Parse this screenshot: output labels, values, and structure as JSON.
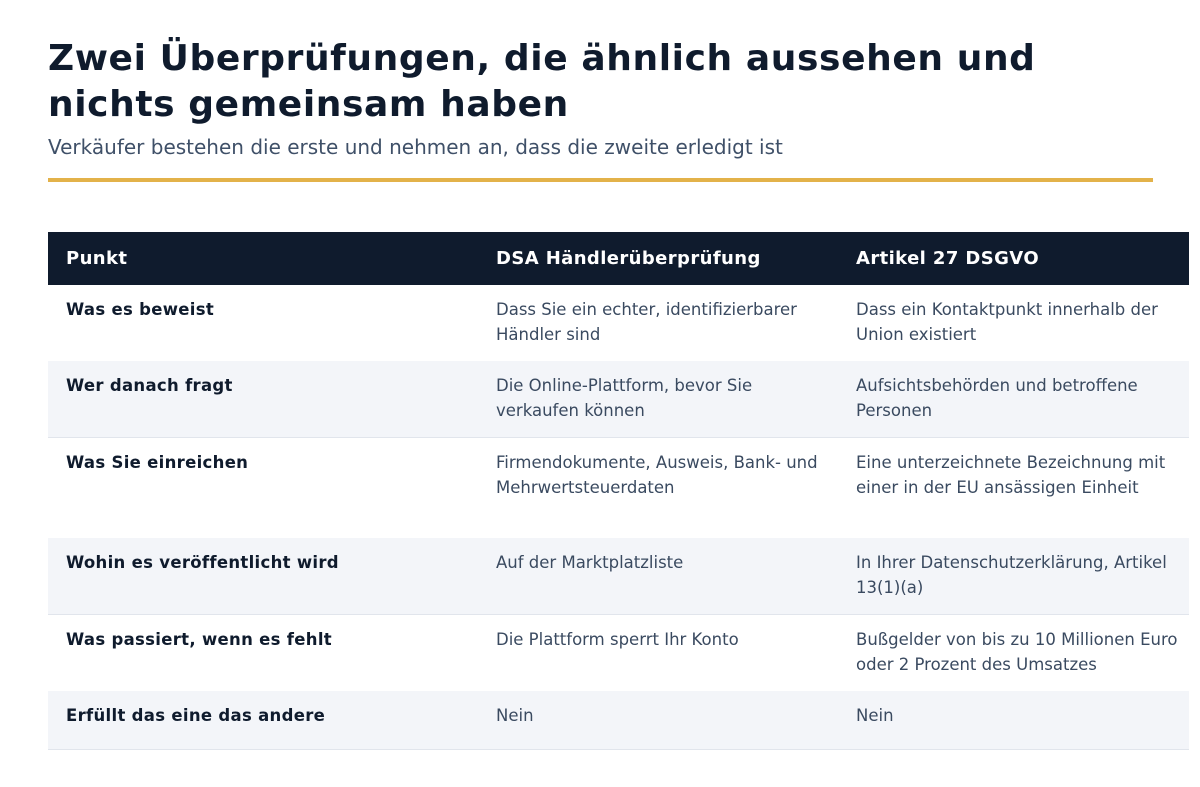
{
  "header": {
    "title": "Zwei Überprüfungen, die ähnlich aussehen und nichts gemeinsam haben",
    "subtitle": "Verkäufer bestehen die erste und nehmen an, dass die zweite erledigt ist",
    "accent_color": "#e3b24a"
  },
  "table": {
    "headers": [
      "Punkt",
      "DSA Händlerüberprüfung",
      "Artikel 27 DSGVO"
    ],
    "header_bg": "#0f1b2d",
    "rows": [
      [
        "Was es beweist",
        "Dass Sie ein echter, identifizierbarer Händler sind",
        "Dass ein Kontaktpunkt innerhalb der Union existiert"
      ],
      [
        "Wer danach fragt",
        "Die Online-Plattform, bevor Sie verkaufen können",
        "Aufsichtsbehörden und betroffene Personen"
      ],
      [
        "Was Sie einreichen",
        "Firmendokumente, Ausweis, Bank- und Mehrwertsteuerdaten",
        "Eine unterzeichnete Bezeichnung mit einer in der EU ansässigen Einheit"
      ],
      [
        "Wohin es veröffentlicht wird",
        "Auf der Marktplatzliste",
        "In Ihrer Datenschutzerklärung, Artikel 13(1)(a)"
      ],
      [
        "Was passiert, wenn es fehlt",
        "Die Plattform sperrt Ihr Konto",
        "Bußgelder von bis zu 10 Millionen Euro oder 2 Prozent des Umsatzes"
      ],
      [
        "Erfüllt das eine das andere",
        "Nein",
        "Nein"
      ]
    ]
  }
}
